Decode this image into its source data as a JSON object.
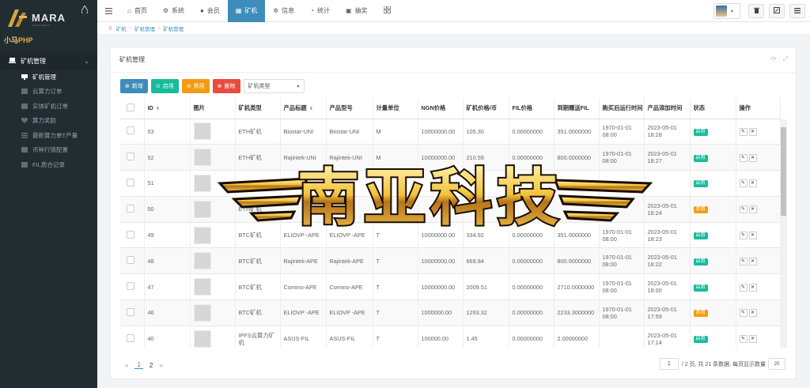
{
  "sidebar": {
    "logo_text": "MARA",
    "logo_sub": "DIGITAL MINING",
    "logo_brand_cn": "小马",
    "logo_brand_php": "PHP",
    "menu_title": "矿机管理",
    "items": [
      {
        "label": "矿机管理",
        "active": true
      },
      {
        "label": "云算力订单",
        "active": false
      },
      {
        "label": "实体矿机订单",
        "active": false
      },
      {
        "label": "算力奖励",
        "active": false
      },
      {
        "label": "最新算力单T产量",
        "active": false
      },
      {
        "label": "币种行情配置",
        "active": false
      },
      {
        "label": "FIL质合记录",
        "active": false
      }
    ]
  },
  "topnav": {
    "tabs": [
      {
        "icon": "home-icon",
        "glyph": "⌂",
        "label": "首页",
        "active": false
      },
      {
        "icon": "gear-icon",
        "glyph": "⚙",
        "label": "系统",
        "active": false
      },
      {
        "icon": "user-icon",
        "glyph": "●",
        "label": "会员",
        "active": false
      },
      {
        "icon": "miner-icon",
        "glyph": "▦",
        "label": "矿机",
        "active": true
      },
      {
        "icon": "info-icon",
        "glyph": "✲",
        "label": "信息",
        "active": false
      },
      {
        "icon": "chart-icon",
        "glyph": "◔",
        "label": "统计",
        "active": false
      },
      {
        "icon": "gift-icon",
        "glyph": "▣",
        "label": "抽奖",
        "active": false
      }
    ]
  },
  "breadcrumb": [
    "矿机",
    "矿机管理",
    "矿机管理"
  ],
  "panel": {
    "title": "矿机管理"
  },
  "toolbar": {
    "add": "新增",
    "enable": "启用",
    "disable": "禁用",
    "delete": "删除",
    "type_placeholder": "矿机类型"
  },
  "table": {
    "columns": [
      "ID",
      "图片",
      "矿机类型",
      "产品标题",
      "产品型号",
      "计量单位",
      "NGN价格",
      "矿机价格/币",
      "FIL价格",
      "到期赠送FIL",
      "购买后运行时间",
      "产品添加时间",
      "状态",
      "操作"
    ],
    "rows": [
      {
        "id": "53",
        "type": "ETH矿机",
        "title": "Biostar-UNI",
        "model": "Biostar-UNI",
        "unit": "M",
        "ngn": "10000000.00",
        "coin": "105.30",
        "fil": "0.00000000",
        "gift": "351.0000000",
        "run": "1970-01-01 08:00",
        "added": "2023-05-01 18:28",
        "status": "启用",
        "status_on": true
      },
      {
        "id": "52",
        "type": "ETH矿机",
        "title": "Rajintek-UNI",
        "model": "Rajintek-UNI",
        "unit": "M",
        "ngn": "10000000.00",
        "coin": "210.59",
        "fil": "0.00000000",
        "gift": "800.0000000",
        "run": "1970-01-01 08:00",
        "added": "2023-05-01 18:27",
        "status": "启用",
        "status_on": true
      },
      {
        "id": "51",
        "type": "",
        "title": "",
        "model": "",
        "unit": "",
        "ngn": "",
        "coin": "",
        "fil": "",
        "gift": "",
        "run": "",
        "added": "",
        "status": "启用",
        "status_on": true
      },
      {
        "id": "50",
        "type": "ETH矿机",
        "title": "",
        "model": "",
        "unit": "",
        "ngn": "",
        "coin": "",
        "fil": "",
        "gift": "",
        "run": "",
        "added": "2023-05-01 18:24",
        "status": "禁用",
        "status_on": false
      },
      {
        "id": "49",
        "type": "BTC矿机",
        "title": "ELIOVP -APE",
        "model": "ELIOVP -APE",
        "unit": "T",
        "ngn": "10000000.00",
        "coin": "334.92",
        "fil": "0.00000000",
        "gift": "351.0000000",
        "run": "1970-01-01 08:00",
        "added": "2023-05-01 18:23",
        "status": "启用",
        "status_on": true
      },
      {
        "id": "48",
        "type": "BTC矿机",
        "title": "Rajintek-APE",
        "model": "Rajintek-APE",
        "unit": "T",
        "ngn": "10000000.00",
        "coin": "669.84",
        "fil": "0.00000000",
        "gift": "800.0000000",
        "run": "1970-01-01 08:00",
        "added": "2023-05-01 18:22",
        "status": "启用",
        "status_on": true
      },
      {
        "id": "47",
        "type": "BTC矿机",
        "title": "Comino-APE",
        "model": "Comino-APE",
        "unit": "T",
        "ngn": "10000000.00",
        "coin": "2009.51",
        "fil": "0.00000000",
        "gift": "2710.0000000",
        "run": "1970-01-01 08:00",
        "added": "2023-05-01 18:00",
        "status": "启用",
        "status_on": true
      },
      {
        "id": "46",
        "type": "BTC矿机",
        "title": "ELIOVP -APE",
        "model": "ELIOVP -APE",
        "unit": "T",
        "ngn": "1000000.00",
        "coin": "1293.32",
        "fil": "0.00000000",
        "gift": "2233.3000000",
        "run": "1970-01-01 08:00",
        "added": "2023-05-01 17:59",
        "status": "禁用",
        "status_on": false
      },
      {
        "id": "40",
        "type": "IPFS云算力矿机",
        "title": "ASUS-FIL",
        "model": "ASUS-FIL",
        "unit": "T",
        "ngn": "100000.00",
        "coin": "1.45",
        "fil": "0.00000000",
        "gift": "2.00000000",
        "run": "",
        "added": "2023-05-01 17:14",
        "status": "启用",
        "status_on": true
      }
    ]
  },
  "pagination": {
    "prev": "«",
    "pages": [
      "1",
      "2"
    ],
    "next": "»",
    "current_page": "1",
    "summary": "/ 2 页, 共 21 条数据, 每页显示数量",
    "page_size": "20"
  },
  "watermark": {
    "text": "南亚科技"
  },
  "colors": {
    "primary": "#3c8dbc",
    "success": "#18bc9c",
    "warning": "#f39c12",
    "danger": "#e74c3c",
    "sidebar_bg": "#222d32"
  }
}
